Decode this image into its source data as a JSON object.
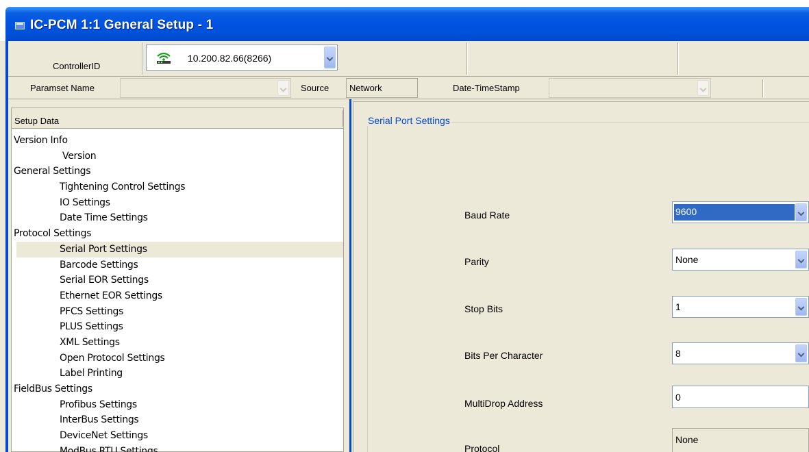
{
  "window": {
    "title": "IC-PCM 1:1 General Setup - 1"
  },
  "header": {
    "controller_label": "ControllerID",
    "controller_value": "10.200.82.66(8266)",
    "paramset_label": "Paramset Name",
    "paramset_value": "",
    "source_label": "Source",
    "source_value": "Network",
    "datetime_label": "Date-TimeStamp",
    "datetime_value": ""
  },
  "tree": {
    "header": "Setup Data",
    "items": [
      {
        "label": "Version Info",
        "level": 0
      },
      {
        "label": "Version",
        "level": 1
      },
      {
        "label": "General Settings",
        "level": 0
      },
      {
        "label": "Tightening Control Settings",
        "level": 1
      },
      {
        "label": "IO Settings",
        "level": 1
      },
      {
        "label": "Date Time Settings",
        "level": 1
      },
      {
        "label": "Protocol Settings",
        "level": 0
      },
      {
        "label": "Serial Port Settings",
        "level": 1,
        "selected": true
      },
      {
        "label": "Barcode Settings",
        "level": 1
      },
      {
        "label": "Serial EOR Settings",
        "level": 1
      },
      {
        "label": "Ethernet EOR Settings",
        "level": 1
      },
      {
        "label": "PFCS Settings",
        "level": 1
      },
      {
        "label": "PLUS Settings",
        "level": 1
      },
      {
        "label": "XML Settings",
        "level": 1
      },
      {
        "label": "Open Protocol Settings",
        "level": 1
      },
      {
        "label": "Label Printing",
        "level": 1
      },
      {
        "label": "FieldBus Settings",
        "level": 0
      },
      {
        "label": "Profibus Settings",
        "level": 1
      },
      {
        "label": "InterBus Settings",
        "level": 1
      },
      {
        "label": "DeviceNet Settings",
        "level": 1
      },
      {
        "label": "ModBus RTU Settings",
        "level": 1
      }
    ]
  },
  "serial": {
    "group_title": "Serial Port Settings",
    "baud_label": "Baud Rate",
    "baud_value": "9600",
    "parity_label": "Parity",
    "parity_value": "None",
    "stopbits_label": "Stop Bits",
    "stopbits_value": "1",
    "bits_label": "Bits Per Character",
    "bits_value": "8",
    "multidrop_label": "MultiDrop Address",
    "multidrop_value": "0",
    "protocol_label": "Protocol",
    "protocol_value": "None"
  },
  "colors": {
    "titlebar": "#0054e3",
    "selection": "#316ac5",
    "group_title": "#0046d5"
  }
}
